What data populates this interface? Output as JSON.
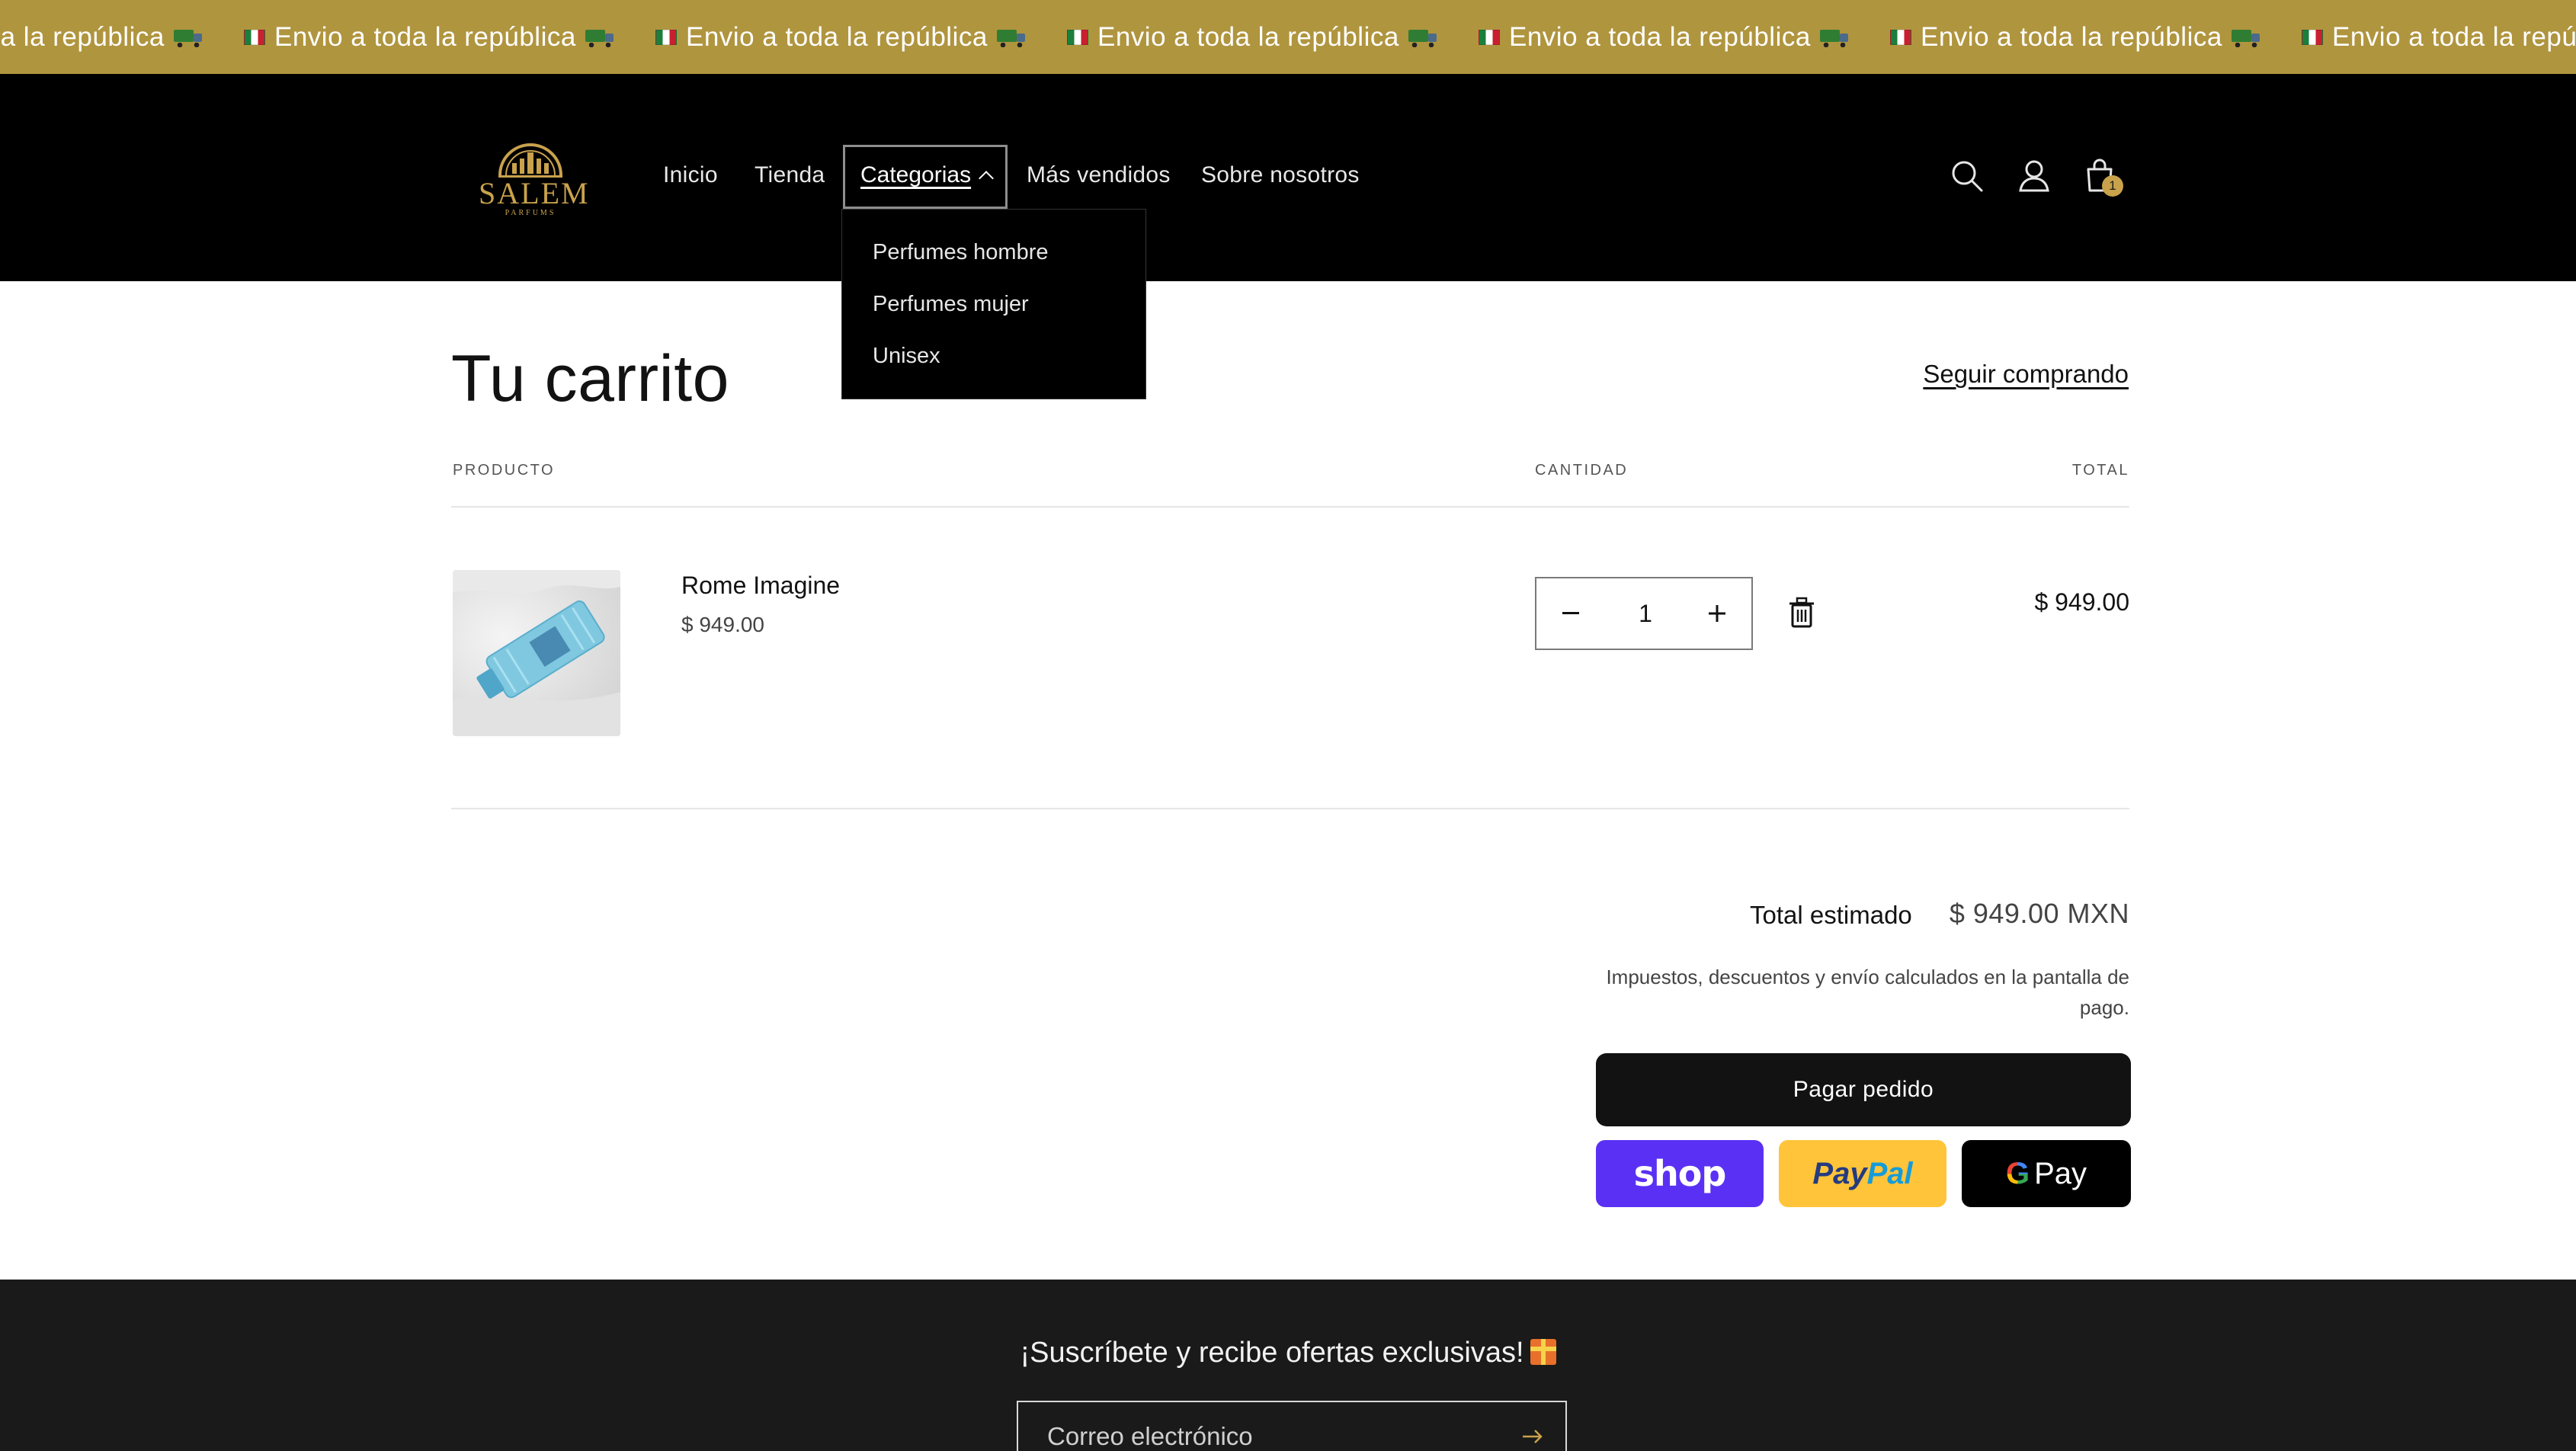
{
  "announcement": {
    "text": "Envio a toda la república",
    "visible_repeats": 7,
    "background": "#b0953f",
    "icons": [
      "mexico-flag-icon",
      "truck-icon"
    ]
  },
  "header": {
    "logo_text": "SALEM",
    "logo_subtext": "PARFUMS",
    "nav": {
      "inicio": "Inicio",
      "tienda": "Tienda",
      "categorias": "Categorias",
      "mas_vendidos": "Más vendidos",
      "sobre_nosotros": "Sobre nosotros"
    },
    "dropdown": [
      "Perfumes hombre",
      "Perfumes mujer",
      "Unisex"
    ],
    "cart_count": "1",
    "icons": [
      "search-icon",
      "account-icon",
      "cart-icon"
    ],
    "accent": "#c9a24c"
  },
  "cart": {
    "title": "Tu carrito",
    "continue_link": "Seguir comprando",
    "columns": {
      "product": "PRODUCTO",
      "quantity": "CANTIDAD",
      "total": "TOTAL"
    },
    "items": [
      {
        "name": "Rome Imagine",
        "price": "$ 949.00",
        "quantity": "1",
        "total": "$ 949.00"
      }
    ]
  },
  "summary": {
    "estimated_label": "Total estimado",
    "estimated_value": "$ 949.00 MXN",
    "tax_note": "Impuestos, descuentos y envío calculados en la pantalla de pago.",
    "checkout_label": "Pagar pedido",
    "shop_pay_label": "shop",
    "paypal_label_1": "Pay",
    "paypal_label_2": "Pal",
    "gpay_g": "G",
    "gpay_label": "Pay"
  },
  "footer": {
    "newsletter_title": "¡Suscríbete y recibe ofertas exclusivas!",
    "email_placeholder": "Correo electrónico"
  }
}
